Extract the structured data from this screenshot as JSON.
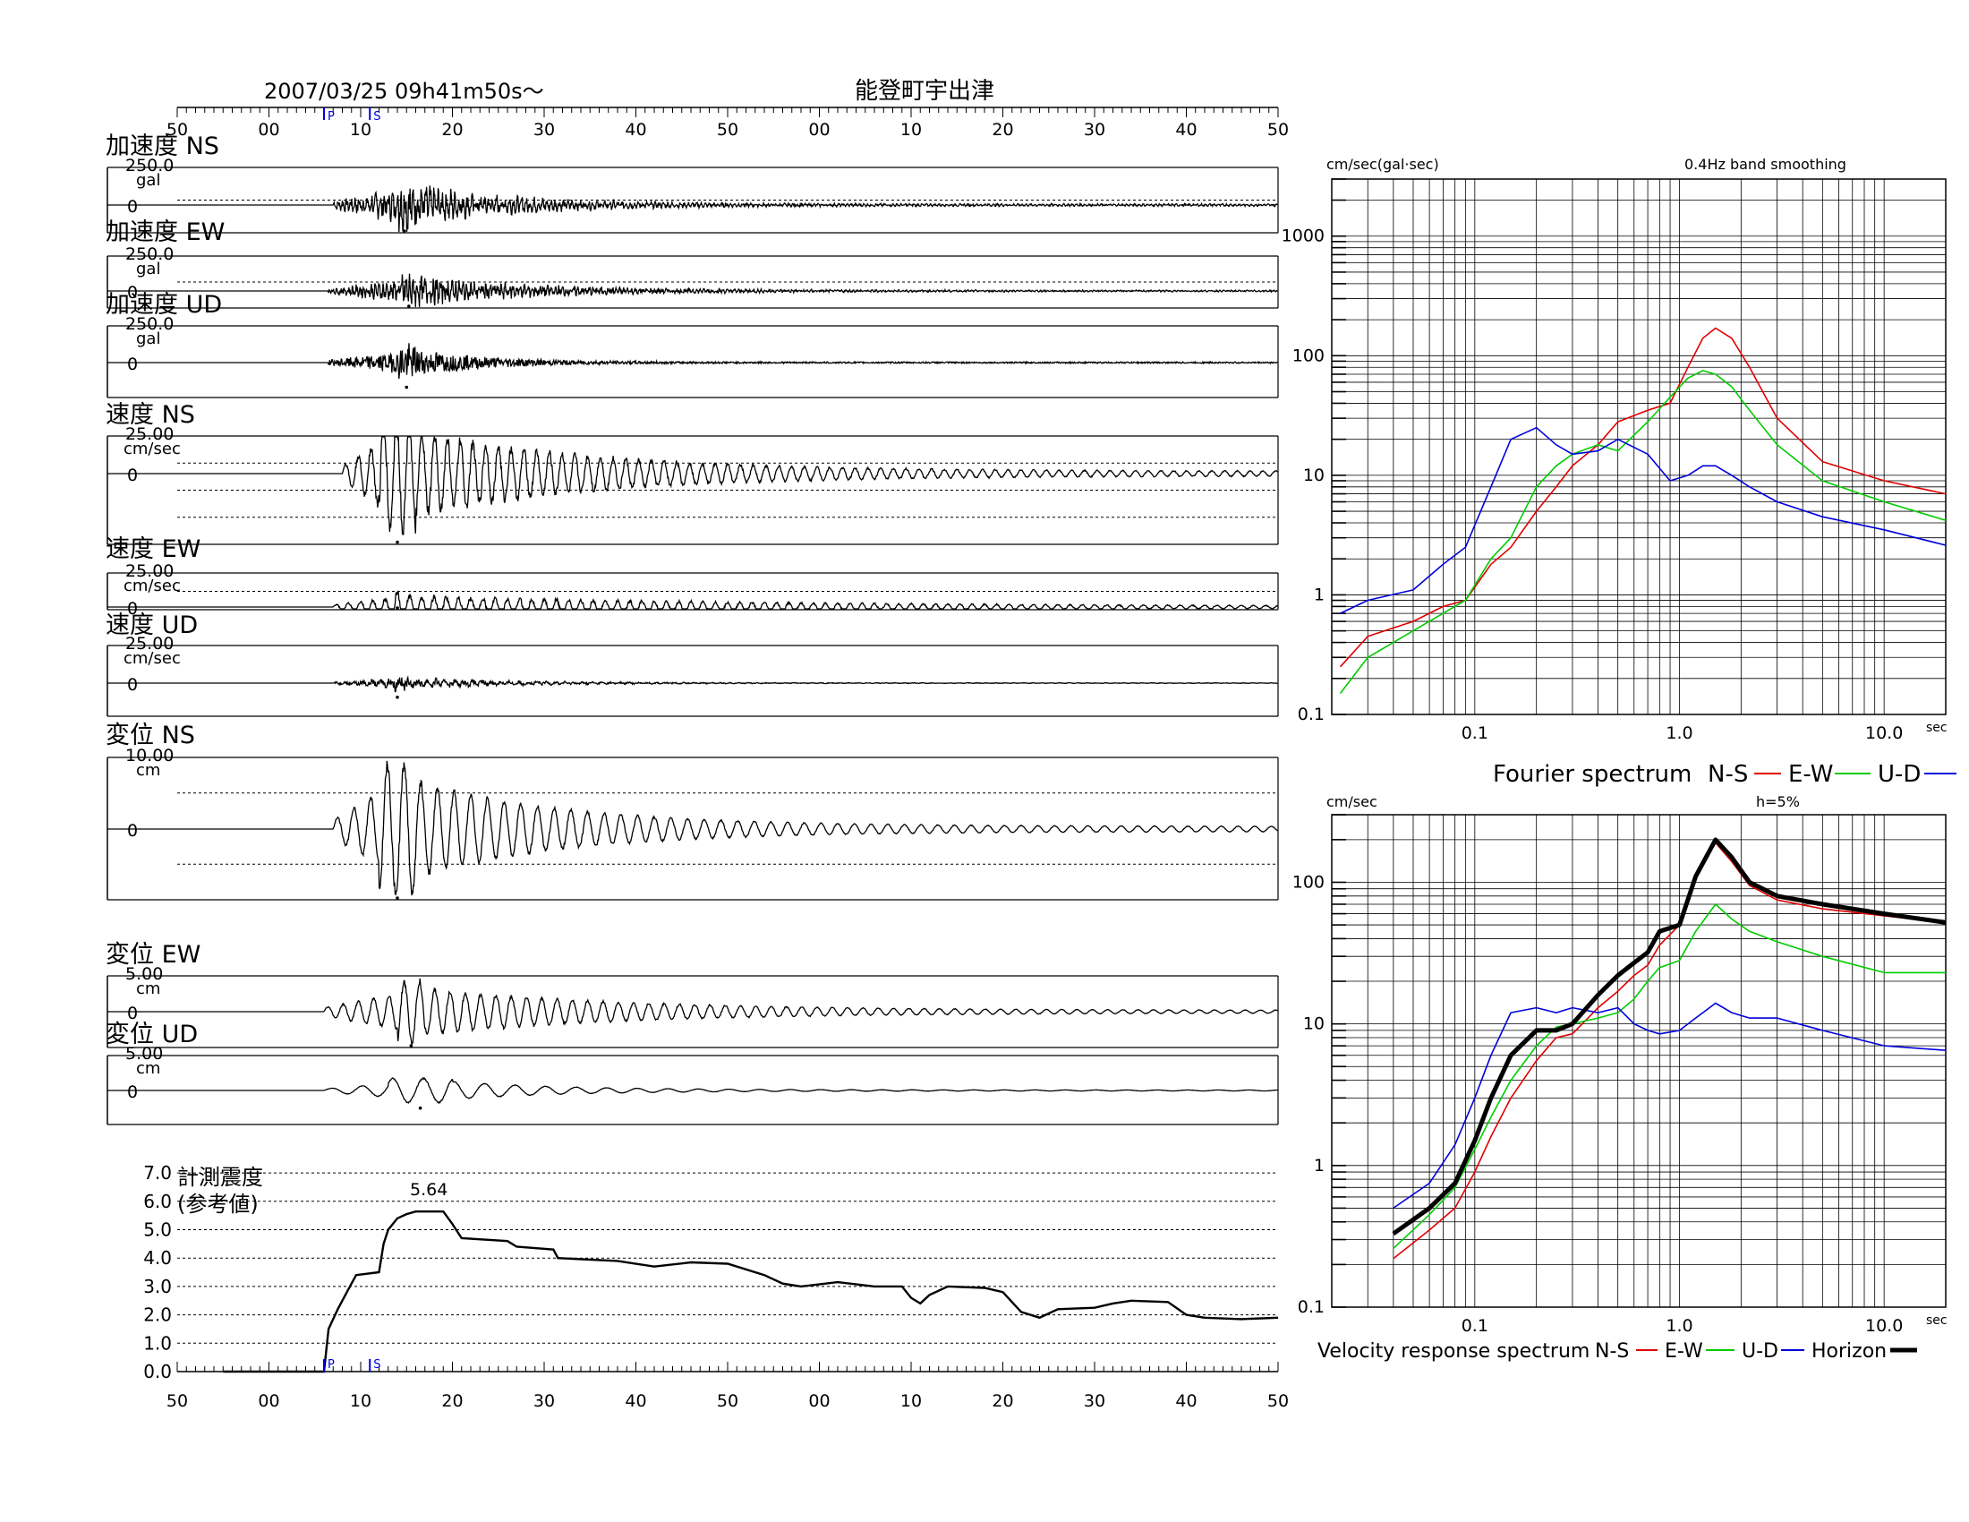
{
  "header": {
    "datetime": "2007/03/25  09h41m50s〜",
    "station": "能登町宇出津"
  },
  "time_axis": {
    "tick_labels": [
      "50",
      "00",
      "10",
      "20",
      "30",
      "40",
      "50",
      "00",
      "10",
      "20",
      "30",
      "40",
      "50"
    ],
    "p_marker": "P",
    "s_marker": "S"
  },
  "panels": [
    {
      "title": "加速度 NS",
      "scale": "250.0",
      "unit": "gal",
      "zero": "0"
    },
    {
      "title": "加速度 EW",
      "scale": "250.0",
      "unit": "gal",
      "zero": "0"
    },
    {
      "title": "加速度 UD",
      "scale": "250.0",
      "unit": "gal",
      "zero": "0"
    },
    {
      "title": "速度 NS",
      "scale": "25.00",
      "unit": "cm/sec",
      "zero": "0"
    },
    {
      "title": "速度 EW",
      "scale": "25.00",
      "unit": "cm/sec",
      "zero": "0"
    },
    {
      "title": "速度 UD",
      "scale": "25.00",
      "unit": "cm/sec",
      "zero": "0"
    },
    {
      "title": "変位 NS",
      "scale": "10.00",
      "unit": "cm",
      "zero": "0"
    },
    {
      "title": "変位 EW",
      "scale": "5.00",
      "unit": "cm",
      "zero": "0"
    },
    {
      "title": "変位 UD",
      "scale": "5.00",
      "unit": "cm",
      "zero": "0"
    }
  ],
  "intensity": {
    "title_line1": "計測震度",
    "title_line2": "(参考値)",
    "peak_label": "5.64",
    "y_ticks": [
      "7.0",
      "6.0",
      "5.0",
      "4.0",
      "3.0",
      "2.0",
      "1.0",
      "0.0"
    ]
  },
  "chart_data": [
    {
      "type": "line",
      "title": "Fourier spectrum",
      "ylabel": "cm/sec(gal·sec)",
      "xlabel": "sec",
      "note": "0.4Hz band smoothing",
      "x_scale": "log",
      "y_scale": "log",
      "xlim": [
        0.02,
        20
      ],
      "ylim": [
        0.1,
        3000
      ],
      "x_tick_labels": [
        "0.1",
        "1.0",
        "10.0"
      ],
      "y_tick_labels": [
        "0.1",
        "1",
        "10",
        "100",
        "1000"
      ],
      "series": [
        {
          "name": "N-S",
          "color": "#e00000",
          "x": [
            0.022,
            0.03,
            0.05,
            0.07,
            0.09,
            0.12,
            0.15,
            0.2,
            0.25,
            0.3,
            0.4,
            0.5,
            0.7,
            0.9,
            1.1,
            1.3,
            1.5,
            1.8,
            2.2,
            3,
            5,
            10,
            20
          ],
          "y": [
            0.25,
            0.45,
            0.6,
            0.8,
            0.9,
            1.8,
            2.5,
            5,
            8,
            12,
            18,
            28,
            35,
            40,
            80,
            140,
            170,
            140,
            80,
            30,
            13,
            9,
            7
          ]
        },
        {
          "name": "E-W",
          "color": "#00cc00",
          "x": [
            0.022,
            0.03,
            0.05,
            0.07,
            0.09,
            0.12,
            0.15,
            0.2,
            0.25,
            0.3,
            0.4,
            0.5,
            0.7,
            0.9,
            1.1,
            1.3,
            1.5,
            1.8,
            2.2,
            3,
            5,
            10,
            20
          ],
          "y": [
            0.15,
            0.3,
            0.5,
            0.7,
            0.9,
            2,
            3,
            8,
            12,
            15,
            18,
            16,
            28,
            45,
            65,
            75,
            70,
            55,
            35,
            18,
            9,
            6,
            4.2
          ]
        },
        {
          "name": "U-D",
          "color": "#0000dd",
          "x": [
            0.022,
            0.03,
            0.05,
            0.07,
            0.09,
            0.12,
            0.15,
            0.2,
            0.25,
            0.3,
            0.4,
            0.5,
            0.7,
            0.9,
            1.1,
            1.3,
            1.5,
            1.8,
            2.2,
            3,
            5,
            10,
            20
          ],
          "y": [
            0.7,
            0.9,
            1.1,
            1.8,
            2.5,
            8,
            20,
            25,
            18,
            15,
            16,
            20,
            15,
            9,
            10,
            12,
            12,
            10,
            8,
            6,
            4.5,
            3.5,
            2.6
          ]
        }
      ],
      "legend": [
        "N-S",
        "E-W",
        "U-D"
      ]
    },
    {
      "type": "line",
      "title": "Velocity response spectrum",
      "ylabel": "cm/sec",
      "xlabel": "sec",
      "note": "h=5%",
      "x_scale": "log",
      "y_scale": "log",
      "xlim": [
        0.02,
        20
      ],
      "ylim": [
        0.1,
        300
      ],
      "x_tick_labels": [
        "0.1",
        "1.0",
        "10.0"
      ],
      "y_tick_labels": [
        "0.1",
        "1",
        "10",
        "100"
      ],
      "series": [
        {
          "name": "N-S",
          "color": "#e00000",
          "x": [
            0.04,
            0.06,
            0.08,
            0.1,
            0.12,
            0.15,
            0.2,
            0.25,
            0.3,
            0.4,
            0.5,
            0.6,
            0.7,
            0.8,
            1.0,
            1.2,
            1.5,
            1.8,
            2.2,
            3,
            5,
            10,
            20
          ],
          "y": [
            0.22,
            0.35,
            0.5,
            0.9,
            1.6,
            3,
            5.5,
            8,
            8.5,
            13,
            17,
            22,
            26,
            36,
            50,
            110,
            190,
            140,
            95,
            75,
            65,
            58,
            52
          ]
        },
        {
          "name": "E-W",
          "color": "#00cc00",
          "x": [
            0.04,
            0.06,
            0.08,
            0.1,
            0.12,
            0.15,
            0.2,
            0.25,
            0.3,
            0.4,
            0.5,
            0.6,
            0.7,
            0.8,
            1.0,
            1.2,
            1.5,
            1.8,
            2.2,
            3,
            5,
            10,
            20
          ],
          "y": [
            0.26,
            0.45,
            0.7,
            1.3,
            2.2,
            4,
            7,
            9.5,
            10,
            11,
            12,
            15,
            20,
            25,
            28,
            45,
            70,
            55,
            45,
            38,
            30,
            23,
            23
          ]
        },
        {
          "name": "U-D",
          "color": "#0000dd",
          "x": [
            0.04,
            0.06,
            0.08,
            0.1,
            0.12,
            0.15,
            0.2,
            0.25,
            0.3,
            0.4,
            0.5,
            0.6,
            0.7,
            0.8,
            1.0,
            1.2,
            1.5,
            1.8,
            2.2,
            3,
            5,
            10,
            20
          ],
          "y": [
            0.5,
            0.75,
            1.4,
            3,
            6,
            12,
            13,
            12,
            13,
            12,
            13,
            10,
            9,
            8.5,
            9,
            11,
            14,
            12,
            11,
            11,
            9,
            7,
            6.5
          ]
        },
        {
          "name": "Horizon",
          "color": "#000000",
          "x": [
            0.04,
            0.06,
            0.08,
            0.1,
            0.12,
            0.15,
            0.2,
            0.25,
            0.3,
            0.4,
            0.5,
            0.6,
            0.7,
            0.8,
            1.0,
            1.2,
            1.5,
            1.8,
            2.2,
            3,
            5,
            10,
            20
          ],
          "y": [
            0.33,
            0.5,
            0.75,
            1.5,
            3,
            6,
            9,
            9,
            10,
            16,
            22,
            27,
            32,
            45,
            50,
            110,
            200,
            150,
            100,
            80,
            70,
            60,
            52
          ]
        }
      ],
      "legend": [
        "N-S",
        "E-W",
        "U-D",
        "Horizon"
      ]
    }
  ]
}
